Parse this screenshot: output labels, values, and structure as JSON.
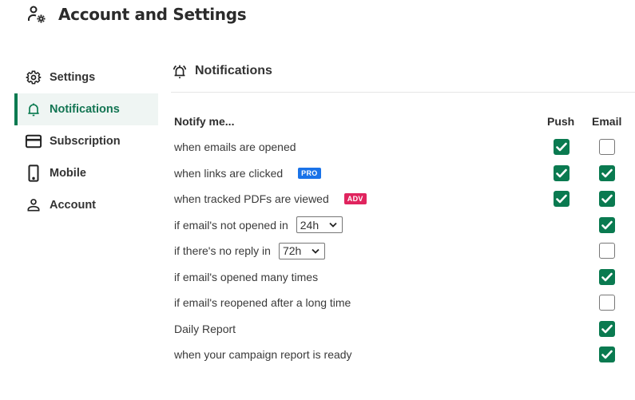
{
  "header": {
    "title": "Account and Settings",
    "icon": "user-gear-icon"
  },
  "sidebar": {
    "items": [
      {
        "label": "Settings",
        "icon": "gear-icon",
        "active": false
      },
      {
        "label": "Notifications",
        "icon": "bell-icon",
        "active": true
      },
      {
        "label": "Subscription",
        "icon": "credit-card-icon",
        "active": false
      },
      {
        "label": "Mobile",
        "icon": "mobile-phone-icon",
        "active": false
      },
      {
        "label": "Account",
        "icon": "user-icon",
        "active": false
      }
    ]
  },
  "section": {
    "title": "Notifications",
    "icon": "bell-ringing-icon"
  },
  "table": {
    "header_label": "Notify me...",
    "col_push": "Push",
    "col_email": "Email",
    "rows": [
      {
        "label": "when emails are opened",
        "push": true,
        "email": false
      },
      {
        "label": "when links are clicked",
        "badge": "PRO",
        "badge_color": "#1a73e8",
        "push": true,
        "email": true
      },
      {
        "label": "when tracked PDFs are viewed",
        "badge": "ADV",
        "badge_color": "#e0245e",
        "push": true,
        "email": true
      },
      {
        "label": "if email's not opened in",
        "select": "24h",
        "push": null,
        "email": true
      },
      {
        "label": "if there's no reply in",
        "select": "72h",
        "push": null,
        "email": false
      },
      {
        "label": "if email's opened many times",
        "push": null,
        "email": true
      },
      {
        "label": "if email's reopened after a long time",
        "push": null,
        "email": false
      },
      {
        "label": "Daily Report",
        "push": null,
        "email": true
      },
      {
        "label": "when your campaign report is ready",
        "push": null,
        "email": true
      }
    ]
  },
  "colors": {
    "accent": "#0a7a50",
    "active_bg": "#eff5f3"
  }
}
